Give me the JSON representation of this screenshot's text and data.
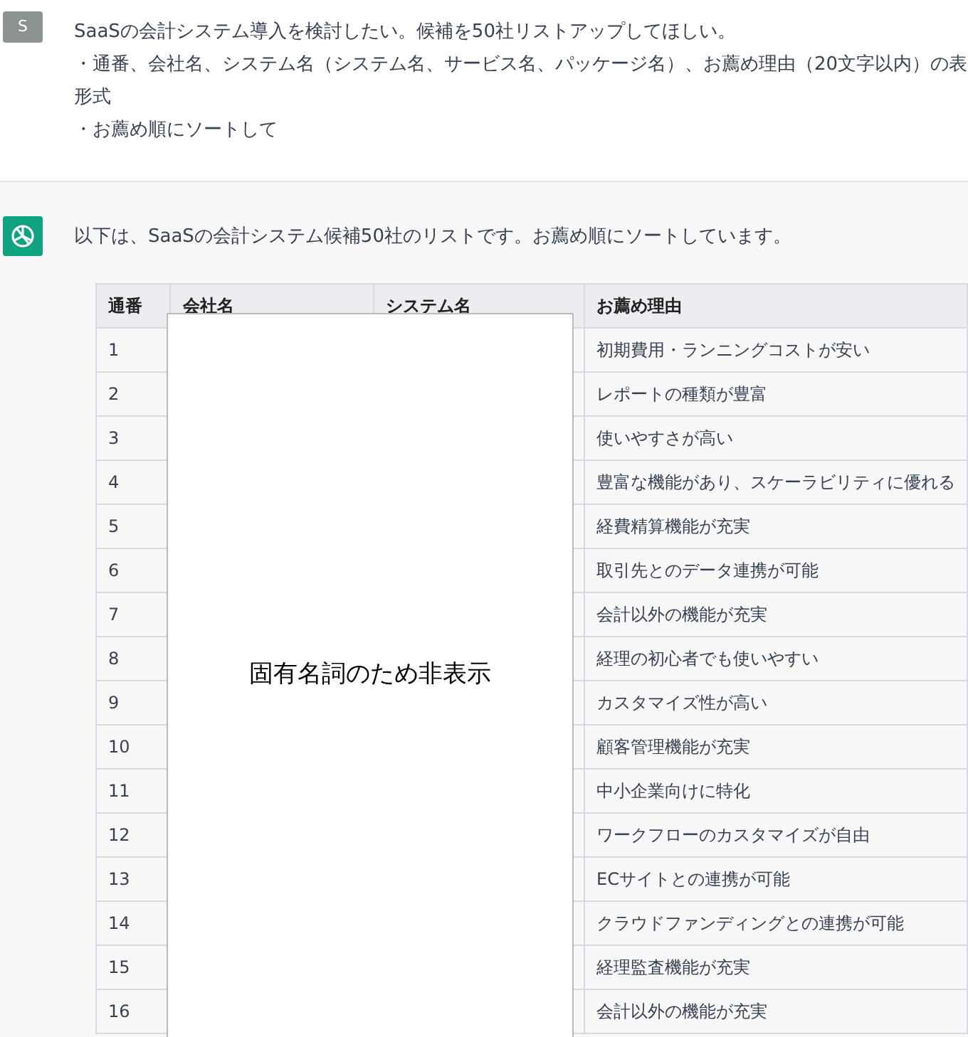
{
  "user_message": {
    "avatar": "S",
    "lines": [
      "SaaSの会計システム導入を検討したい。候補を50社リストアップしてほしい。",
      "・通番、会社名、システム名（システム名、サービス名、パッケージ名）、お薦め理由（20文字以内）の表形式",
      "・お薦め順にソートして"
    ]
  },
  "assistant_message": {
    "text": "以下は、SaaSの会計システム候補50社のリストです。お薦め順にソートしています。",
    "table": {
      "columns": [
        "通番",
        "会社名",
        "システム名",
        "お薦め理由"
      ],
      "rows": [
        {
          "number": "1",
          "reason": "初期費用・ランニングコストが安い"
        },
        {
          "number": "2",
          "reason": "レポートの種類が豊富"
        },
        {
          "number": "3",
          "reason": "使いやすさが高い"
        },
        {
          "number": "4",
          "reason": "豊富な機能があり、スケーラビリティに優れる"
        },
        {
          "number": "5",
          "reason": "経費精算機能が充実"
        },
        {
          "number": "6",
          "reason": "取引先とのデータ連携が可能"
        },
        {
          "number": "7",
          "reason": "会計以外の機能が充実"
        },
        {
          "number": "8",
          "reason": "経理の初心者でも使いやすい"
        },
        {
          "number": "9",
          "reason": "カスタマイズ性が高い"
        },
        {
          "number": "10",
          "reason": "顧客管理機能が充実"
        },
        {
          "number": "11",
          "reason": "中小企業向けに特化"
        },
        {
          "number": "12",
          "reason": "ワークフローのカスタマイズが自由"
        },
        {
          "number": "13",
          "reason": "ECサイトとの連携が可能"
        },
        {
          "number": "14",
          "reason": "クラウドファンディングとの連携が可能"
        },
        {
          "number": "15",
          "reason": "経理監査機能が充実"
        },
        {
          "number": "16",
          "reason": "会計以外の機能が充実"
        }
      ]
    },
    "redaction_note": "固有名詞のため非表示"
  }
}
